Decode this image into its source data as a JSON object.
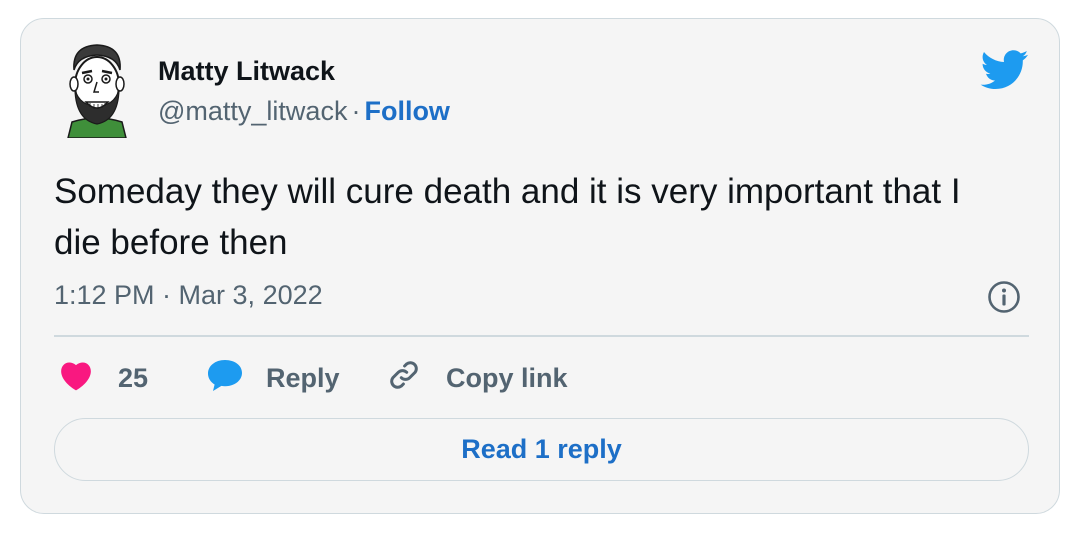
{
  "author": {
    "name": "Matty Litwack",
    "handle": "@matty_litwack",
    "separator": "·",
    "follow_label": "Follow"
  },
  "tweet": {
    "text": "Someday they will cure death and it is very important that I die before then",
    "timestamp": "1:12 PM · Mar 3, 2022"
  },
  "actions": {
    "like_count": "25",
    "reply_label": "Reply",
    "copy_link_label": "Copy link"
  },
  "read_replies_label": "Read 1 reply",
  "colors": {
    "accent": "#1d6fc7",
    "twitter_blue": "#1d9bf0",
    "like_pink": "#f91880",
    "border": "#cfd9de",
    "muted_text": "#536471"
  },
  "icons": [
    "avatar-drawing",
    "twitter-bird-icon",
    "info-icon",
    "heart-icon",
    "reply-bubble-icon",
    "link-icon"
  ]
}
